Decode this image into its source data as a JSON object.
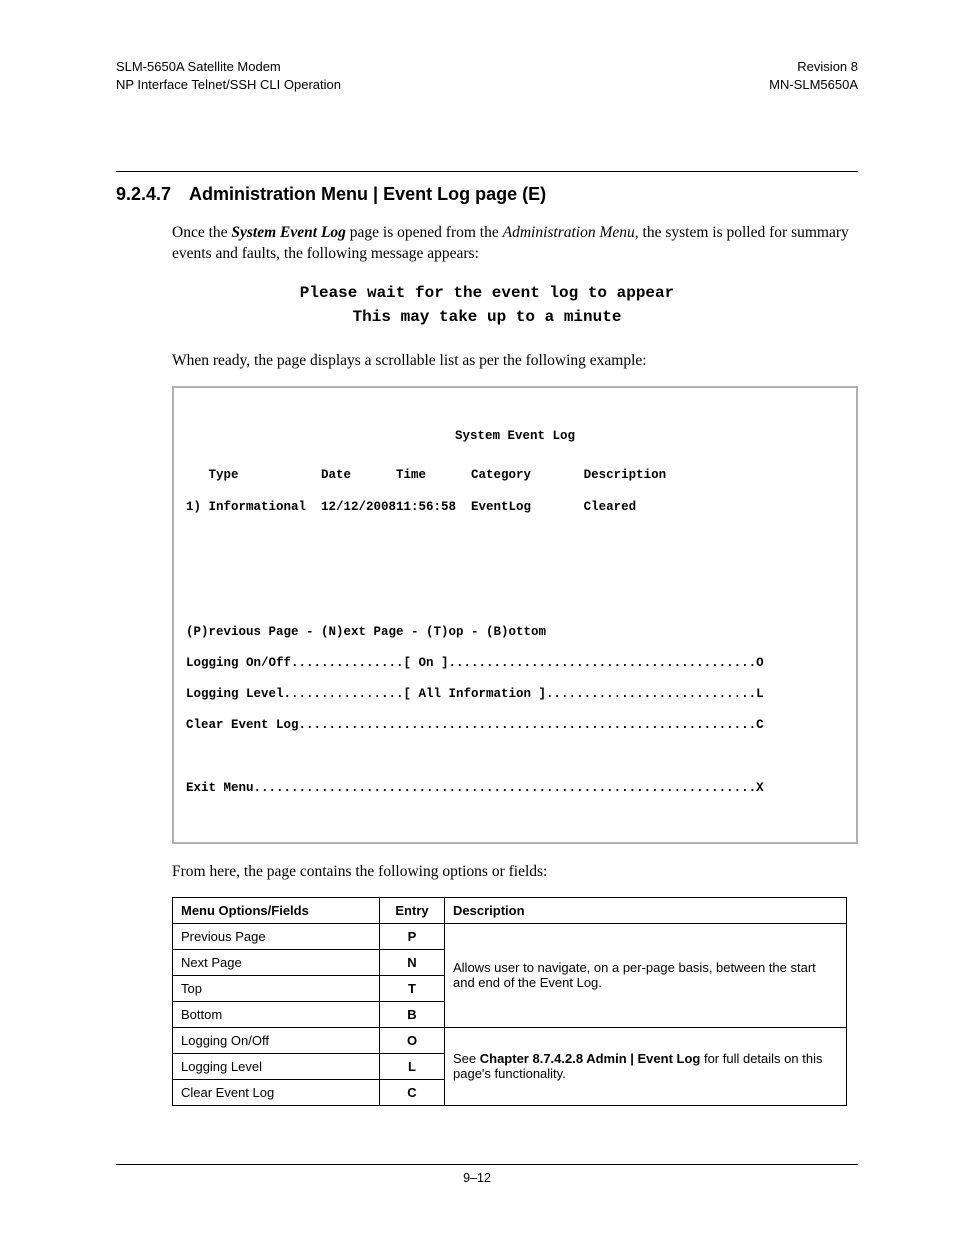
{
  "header": {
    "left_line1": "SLM-5650A Satellite Modem",
    "left_line2": "NP Interface Telnet/SSH CLI Operation",
    "right_line1": "Revision 8",
    "right_line2": "MN-SLM5650A"
  },
  "section": {
    "number": "9.2.4.7",
    "title": "Administration Menu | Event Log page (E)"
  },
  "para1_a": "Once the ",
  "para1_b_bi": "System Event Log",
  "para1_c": " page is opened from the ",
  "para1_d_i": "Administration Menu",
  "para1_e": ", the system is polled for summary events and faults, the following message appears:",
  "wait_line1": "Please wait for the event log to appear",
  "wait_line2": "This may take up to a minute",
  "para2": "When ready, the page displays a scrollable list as per the following example:",
  "terminal": {
    "title": "System Event Log",
    "hdr": "   Type           Date      Time      Category       Description",
    "row1": "1) Informational  12/12/200811:56:58  EventLog       Cleared",
    "nav": "(P)revious Page - (N)ext Page - (T)op - (B)ottom",
    "opt1": "Logging On/Off...............[ On ].........................................O",
    "opt2": "Logging Level................[ All Information ]............................L",
    "opt3": "Clear Event Log.............................................................C",
    "exit": "Exit Menu...................................................................X"
  },
  "para3": "From here, the page contains the following options or fields:",
  "table": {
    "head": {
      "c1": "Menu Options/Fields",
      "c2": "Entry",
      "c3": "Description"
    },
    "rows_nav": [
      {
        "opt": "Previous Page",
        "entry": "P"
      },
      {
        "opt": "Next Page",
        "entry": "N"
      },
      {
        "opt": "Top",
        "entry": "T"
      },
      {
        "opt": "Bottom",
        "entry": "B"
      }
    ],
    "desc_nav": "Allows user to navigate, on a per-page basis, between the start and end of the Event Log.",
    "rows_log": [
      {
        "opt": "Logging On/Off",
        "entry": "O"
      },
      {
        "opt": "Logging Level",
        "entry": "L"
      },
      {
        "opt": "Clear Event Log",
        "entry": "C"
      }
    ],
    "desc_log_a": "See ",
    "desc_log_b_bold": "Chapter 8.7.4.2.8 Admin | Event Log",
    "desc_log_c": " for full details on this page's functionality."
  },
  "footer": "9–12"
}
